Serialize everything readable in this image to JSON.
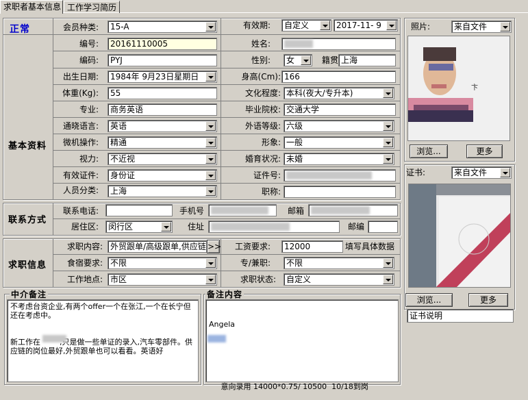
{
  "tabs": [
    {
      "label": "求职者基本信息"
    },
    {
      "label": "工作学习简历"
    }
  ],
  "status": {
    "text": "正常",
    "color": "#0000cc"
  },
  "sections": {
    "basic": "基本资料",
    "contact": "联系方式",
    "job": "求职信息",
    "agent_note": "中介备注",
    "note_content": "备注内容"
  },
  "labels": {
    "member_type": "会员种类:",
    "validity": "有效期:",
    "number": "编号:",
    "name": "姓名:",
    "code": "编码:",
    "gender": "性别:",
    "native": "籍贯",
    "birthday": "出生日期:",
    "height": "身高(Cm):",
    "weight": "体重(Kg):",
    "education": "文化程度:",
    "major": "专业:",
    "school": "毕业院校:",
    "language": "通晓语言:",
    "foreign_level": "外语等级:",
    "computer": "微机操作:",
    "image": "形象:",
    "vision": "视力:",
    "marriage": "婚育状况:",
    "id_type": "有效证件:",
    "id_no": "证件号:",
    "person_type": "人员分类:",
    "title": "职称:",
    "phone": "联系电话:",
    "mobile": "手机号",
    "email": "邮箱",
    "district": "居住区:",
    "address": "住址",
    "zip": "邮编",
    "job_content": "求职内容:",
    "salary": "工资要求:",
    "salary_hint": "填写具体数据",
    "lodging": "食宿要求:",
    "fulltime": "专/兼职:",
    "location": "工作地点:",
    "job_status": "求职状态:",
    "photo": "照片:",
    "cert": "证书:"
  },
  "values": {
    "member_type": "15-A",
    "validity_mode": "自定义",
    "validity_date": "2017-11- 9",
    "number": "20161110005",
    "name": "",
    "code": "PYJ",
    "gender": "女",
    "native": "上海",
    "birthday": "1984年 9月23日星期日",
    "height": "166",
    "weight": "55",
    "education": "本科(夜大/专升本)",
    "major": "商务英语",
    "school": "交通大学",
    "language": "英语",
    "foreign_level": "六级",
    "computer": "精通",
    "image": "一般",
    "vision": "不近视",
    "marriage": "未婚",
    "id_type": "身份证",
    "id_no": "",
    "person_type": "上海",
    "title": "",
    "phone": "",
    "mobile": "",
    "email": "",
    "district": "闵行区",
    "address": "",
    "zip": "",
    "job_content": "外贸跟单/高级跟单,供应链",
    "salary": "12000",
    "lodging": "不限",
    "fulltime": "不限",
    "location": "市区",
    "job_status": "自定义",
    "photo_source": "来自文件",
    "cert_source": "来自文件",
    "cert_desc": "证书说明"
  },
  "buttons": {
    "more_job": ">>",
    "photo_browse": "浏览...",
    "photo_more": "更多",
    "cert_browse": "浏览...",
    "cert_more": "更多"
  },
  "notes": {
    "agent_note": "不考虑台资企业,有两个offer一个在张江,一个在长宁但还在考虑中。\n\n\n新工作在        ,只是做一些单证的录入,汽车零部件。供应链的岗位最好,外贸跟单也可以看看。英语好",
    "note_content_line1": "Angela",
    "note_content_line2": "     意向录用 14000*0.75/ 10500  10/18到岗"
  },
  "colors": {
    "background": "#d4d0c8",
    "accent": "#0000cc",
    "highlight_field": "#ffffe1"
  }
}
